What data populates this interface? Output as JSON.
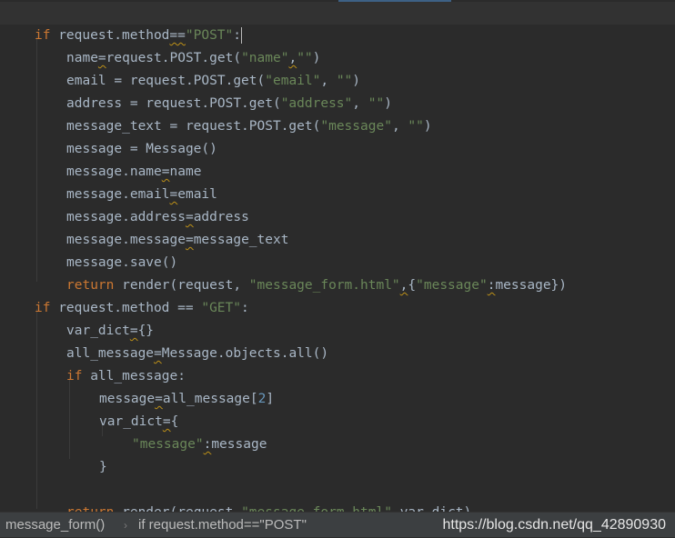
{
  "editor": {
    "code_lines": [
      {
        "text": "if request.method==\"POST\":",
        "current": true
      },
      {
        "text": "name=request.POST.get(\"name\",\"\")"
      },
      {
        "text": "email = request.POST.get(\"email\", \"\")"
      },
      {
        "text": "address = request.POST.get(\"address\", \"\")"
      },
      {
        "text": "message_text = request.POST.get(\"message\", \"\")"
      },
      {
        "text": "message = Message()"
      },
      {
        "text": "message.name=name"
      },
      {
        "text": "message.email=email"
      },
      {
        "text": "message.address=address"
      },
      {
        "text": "message.message=message_text"
      },
      {
        "text": "message.save()"
      },
      {
        "text": "return render(request, \"message_form.html\",{\"message\":message})"
      },
      {
        "text": "if request.method == \"GET\":"
      },
      {
        "text": "var_dict={}"
      },
      {
        "text": "all_message=Message.objects.all()"
      },
      {
        "text": "if all_message:"
      },
      {
        "text": "message=all_message[2]"
      },
      {
        "text": "var_dict={"
      },
      {
        "text": "\"message\":message"
      },
      {
        "text": "}"
      },
      {
        "text": ""
      },
      {
        "text": "return render(request,\"message_form.html\",var_dict)"
      }
    ]
  },
  "breadcrumb": {
    "function": "message_form()",
    "separator": "›",
    "statement": "if request.method==\"POST\""
  },
  "watermark": "https://blog.csdn.net/qq_42890930",
  "colors": {
    "background": "#2b2b2b",
    "keyword": "#cc7832",
    "string": "#6a8759",
    "number": "#6897bb",
    "identifier": "#a9b7c6",
    "statusbar": "#3c3f41"
  }
}
